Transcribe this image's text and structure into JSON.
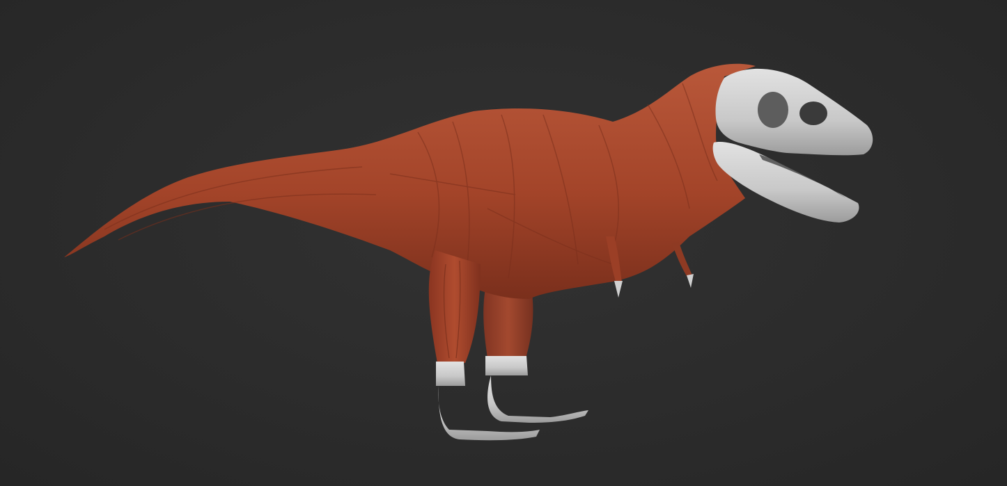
{
  "viewport": {
    "background_color": "#2c2c2c"
  },
  "model": {
    "subject": "tyrannosaurus-rex",
    "muscle_color": "#a8472c",
    "muscle_shadow": "#7a2f1c",
    "muscle_highlight": "#c4603f",
    "bone_color": "#cfcfcf",
    "bone_shadow": "#9a9a9a"
  }
}
